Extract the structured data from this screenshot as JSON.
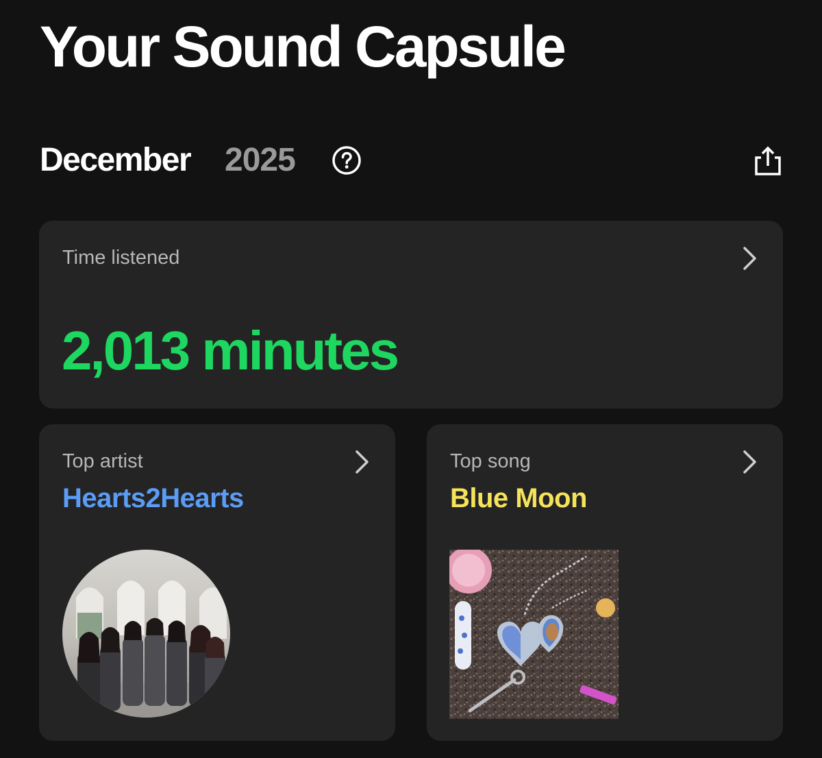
{
  "header": {
    "title": "Your Sound Capsule"
  },
  "period": {
    "month": "December",
    "year": "2025",
    "help_icon": "question-circle-icon",
    "share_icon": "share-icon"
  },
  "time_listened": {
    "label": "Time listened",
    "value": "2,013 minutes",
    "value_color": "#1ed760"
  },
  "top_artist": {
    "label": "Top artist",
    "name": "Hearts2Hearts",
    "name_color": "#5b9cf5",
    "image_icon": "artist-photo"
  },
  "top_song": {
    "label": "Top song",
    "name": "Blue Moon",
    "name_color": "#f5e35a",
    "image_icon": "album-cover"
  },
  "colors": {
    "background": "#121212",
    "card": "#242424",
    "muted_text": "#b7b7b7",
    "year_text": "#9a9a9a"
  }
}
